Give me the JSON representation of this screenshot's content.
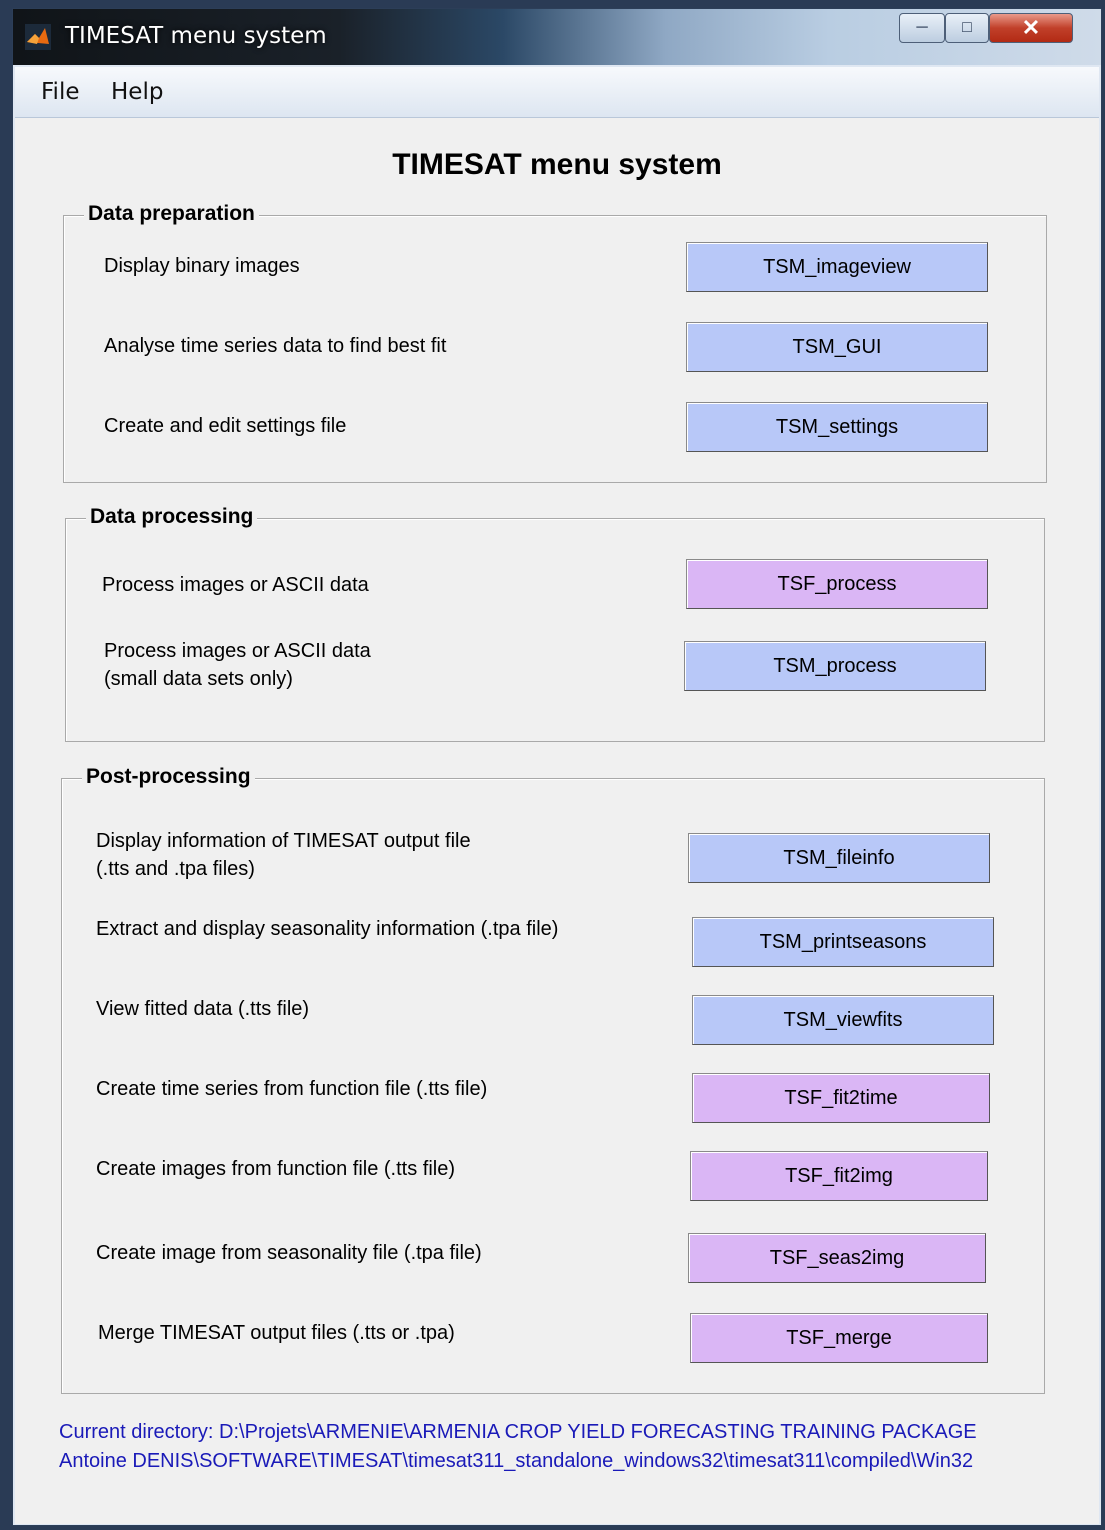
{
  "window": {
    "title": "TIMESAT menu system",
    "icon": "matlab-icon",
    "controls": {
      "minimize_icon": "minimize-icon",
      "maximize_icon": "maximize-icon",
      "close_icon": "close-icon"
    }
  },
  "menubar": {
    "items": [
      "File",
      "Help"
    ]
  },
  "main_title": "TIMESAT menu system",
  "colors": {
    "blue_button": "#b8c8f8",
    "purple_button": "#dab6f5",
    "directory_text": "#1a1ab8"
  },
  "sections": [
    {
      "title": "Data preparation",
      "rows": [
        {
          "label": [
            "Display binary images"
          ],
          "button": "TSM_imageview"
        },
        {
          "label": [
            "Analyse time series data to find best fit"
          ],
          "button": "TSM_GUI"
        },
        {
          "label": [
            "Create and edit settings file"
          ],
          "button": "TSM_settings"
        }
      ]
    },
    {
      "title": "Data processing",
      "rows": [
        {
          "label": [
            "Process images or ASCII data"
          ],
          "button": "TSF_process"
        },
        {
          "label": [
            "Process images or ASCII data",
            "(small data sets only)"
          ],
          "button": "TSM_process"
        }
      ]
    },
    {
      "title": "Post-processing",
      "rows": [
        {
          "label": [
            "Display information of TIMESAT output file",
            "(.tts and .tpa files)"
          ],
          "button": "TSM_fileinfo"
        },
        {
          "label": [
            "Extract and display seasonality information (.tpa file)"
          ],
          "button": "TSM_printseasons"
        },
        {
          "label": [
            "View fitted data (.tts file)"
          ],
          "button": "TSM_viewfits"
        },
        {
          "label": [
            "Create time series from function file (.tts file)"
          ],
          "button": "TSF_fit2time"
        },
        {
          "label": [
            "Create images from function file (.tts file)"
          ],
          "button": "TSF_fit2img"
        },
        {
          "label": [
            "Create image from seasonality file (.tpa file)"
          ],
          "button": "TSF_seas2img"
        },
        {
          "label": [
            "Merge TIMESAT output files (.tts or .tpa)"
          ],
          "button": "TSF_merge"
        }
      ]
    }
  ],
  "current_directory": {
    "line1": "Current directory:  D:\\Projets\\ARMENIE\\ARMENIA CROP YIELD FORECASTING TRAINING PACKAGE",
    "line2": "Antoine DENIS\\SOFTWARE\\TIMESAT\\timesat311_standalone_windows32\\timesat311\\compiled\\Win32"
  }
}
